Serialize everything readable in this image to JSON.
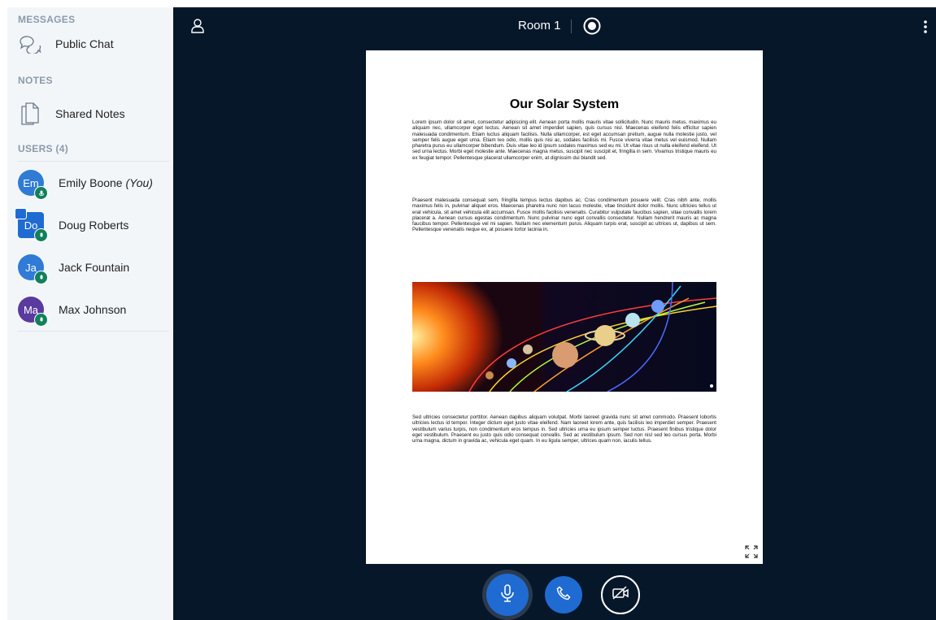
{
  "sidebar": {
    "messages_title": "MESSAGES",
    "public_chat_label": "Public Chat",
    "notes_title": "NOTES",
    "shared_notes_label": "Shared Notes",
    "users_title": "USERS (4)",
    "users": [
      {
        "initials": "Em",
        "name": "Emily Boone",
        "suffix": "(You)",
        "color": "#2f7bd6",
        "mic_color": "#12805c"
      },
      {
        "initials": "Do",
        "name": "Doug Roberts",
        "suffix": "",
        "color": "#1f6bd1",
        "mic_color": "#12805c"
      },
      {
        "initials": "Ja",
        "name": "Jack Fountain",
        "suffix": "",
        "color": "#2f7bd6",
        "mic_color": "#1f6bd1"
      },
      {
        "initials": "Ma",
        "name": "Max Johnson",
        "suffix": "",
        "color": "#5a3a9e",
        "mic_color": "#1f6bd1"
      }
    ]
  },
  "header": {
    "room_title": "Room 1",
    "icons": {
      "user": "user-icon",
      "record": "record-icon",
      "menu": "kebab-menu-icon"
    }
  },
  "slide": {
    "title": "Our Solar System",
    "paragraph1": "Lorem ipsum dolor sit amet, consectetur adipiscing elit. Aenean porta mollis mauris vitae sollicitudin. Nunc mauris metus, maximus eu aliquam nec, ullamcorper eget lectus. Aenean sit amet imperdiet sapien, quis cursus nisl. Maecenas eleifend felis efficitur sapien malesuada condimentum. Etiam luctus aliquam facilisis. Nulla ullamcorper, est eget accumsan pretium, augue nulla molestie justo, vel semper felis augue eget urna. Etiam leo odio, mollis quis nisi ac, sodales facilisis mi. Fusce viverra vitae metus vel euismod. Nullam pharetra purus eu ullamcorper bibendum. Duis vitae leo id ipsum sodales maximus sed eu mi. Ut vitae risus ut nulla eleifend eleifend. Ut sed urna lectus. Morbi eget molestie ante. Maecenas magna metus, suscipit nec suscipit et, fringilla in sem. Vivamus tristique mauris eu ex feugiat tempor. Pellentesque placerat ullamcorper enim, at dignissim dui blandit sed.",
    "paragraph2": "Praesent malesuada consequat sem, fringilla tempus lectus dapibus ac. Cras condimentum posuere velit. Cras nibh ante, mollis maximus felis in, pulvinar aliquet eros. Maecenas pharetra nunc non lacus molestie, vitae tincidunt dolor mollis. Nunc ultricies tellus ut erat vehicula, sit amet vehicula elit accumsan. Fusce mollis facilisis venenatis. Curabitur vulputate faucibus sapien, vitae convallis lorem placerat a. Aenean cursus egestas condimentum. Nunc pulvinar nunc eget convallis consectetur. Nullam hendrerit mauris ac magna faucibus tempor. Pellentesque vel mi sapien. Nullam nec elementum purus. Aliquam turpis erat, suscipit ac ultrices ut, dapibus ut sem. Pellentesque venenatis neque ex, at posuere tortor lacinia in.",
    "paragraph3": "Sed ultricies consectetur porttitor. Aenean dapibus aliquam volutpat. Morbi laoreet gravida nunc sit amet commodo. Praesent lobortis ultricies lectus id tempor. Integer dictum eget justo vitae eleifend. Nam laoreet lorem ante, quis facilisis leo imperdiet semper. Praesent vestibulum varius turpis, non condimentum eros tempus in. Sed ultricies urna eu ipsum semper luctus. Praesent finibus tristique dolor eget vestibulum. Praesent eu justo quis odio consequat convallis. Sed ac vestibulum ipsum. Sed non nisl sed leo cursus porta. Morbi urna magna, dictum in gravida ac, vehicula eget quam. In eu ligula semper, ultrices quam non, iaculis tellus.",
    "image_icon": "solar-system-image"
  },
  "controls": {
    "icons": [
      "microphone-icon",
      "phone-icon",
      "video-off-icon",
      "fullscreen-icon"
    ]
  },
  "colors": {
    "sidebar_bg": "#f3f6f9",
    "main_bg": "#06172a",
    "accent": "#1f6bd1"
  }
}
